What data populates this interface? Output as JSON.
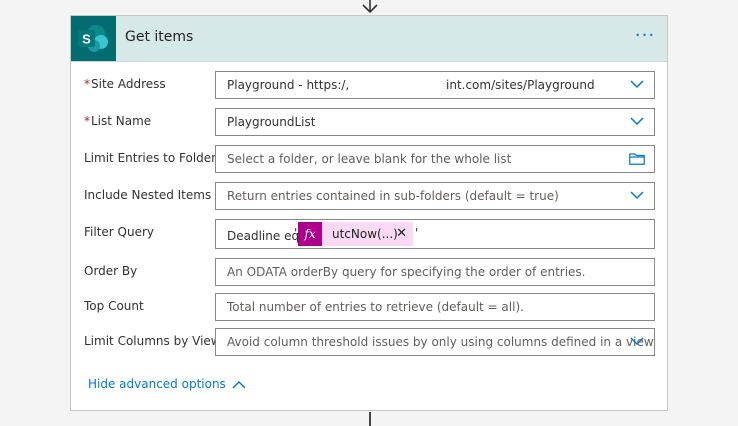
{
  "action": {
    "title": "Get items",
    "more_label": "···",
    "icon": "sharepoint-icon",
    "accent_color": "#036c70"
  },
  "fields": {
    "site_address": {
      "label": "Site Address",
      "required_mark": "*",
      "value_prefix": "Playground - https:/,",
      "value_suffix": "int.com/sites/Playground"
    },
    "list_name": {
      "label": "List Name",
      "required_mark": "*",
      "value": "PlaygroundList"
    },
    "limit_folder": {
      "label": "Limit Entries to Folder",
      "placeholder": "Select a folder, or leave blank for the whole list"
    },
    "nested_items": {
      "label": "Include Nested Items",
      "placeholder": "Return entries contained in sub-folders (default = true)"
    },
    "filter_query": {
      "label": "Filter Query",
      "prefix_text": "Deadline eq",
      "quote_open": "'",
      "quote_close": "'",
      "token_icon": "fx",
      "token_label": "utcNow(...)",
      "token_close": "✕"
    },
    "order_by": {
      "label": "Order By",
      "placeholder": "An ODATA orderBy query for specifying the order of entries."
    },
    "top_count": {
      "label": "Top Count",
      "placeholder": "Total number of entries to retrieve (default = all)."
    },
    "limit_columns": {
      "label": "Limit Columns by View",
      "placeholder": "Avoid column threshold issues by only using columns defined in a view"
    }
  },
  "advanced": {
    "toggle_label": "Hide advanced options"
  }
}
